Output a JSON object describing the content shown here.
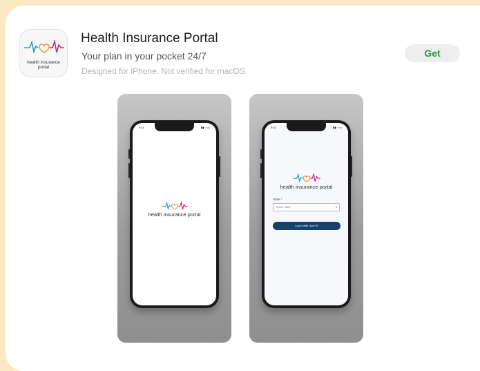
{
  "app": {
    "title": "Health Insurance Portal",
    "subtitle": "Your plan in your pocket 24/7",
    "designed_note": "Designed for iPhone. Not verified for macOS.",
    "get_label": "Get",
    "icon_text_line1": "health insurance",
    "icon_text_line2": "portal"
  },
  "screenshots": [
    {
      "status_time": "9:41",
      "logo_text": "health insurance portal"
    },
    {
      "status_time": "9:41",
      "logo_text": "health insurance portal",
      "state_label": "State",
      "state_required": "*",
      "state_placeholder": "Select State",
      "login_label": "Log in with User ID"
    }
  ],
  "colors": {
    "accent_green": "#2b9a45",
    "login_button": "#16406e",
    "heartbeat_blue": "#1aa3c8",
    "heartbeat_orange": "#f29a38",
    "heartbeat_pink": "#d4237a",
    "page_border": "#fbe7c4"
  }
}
